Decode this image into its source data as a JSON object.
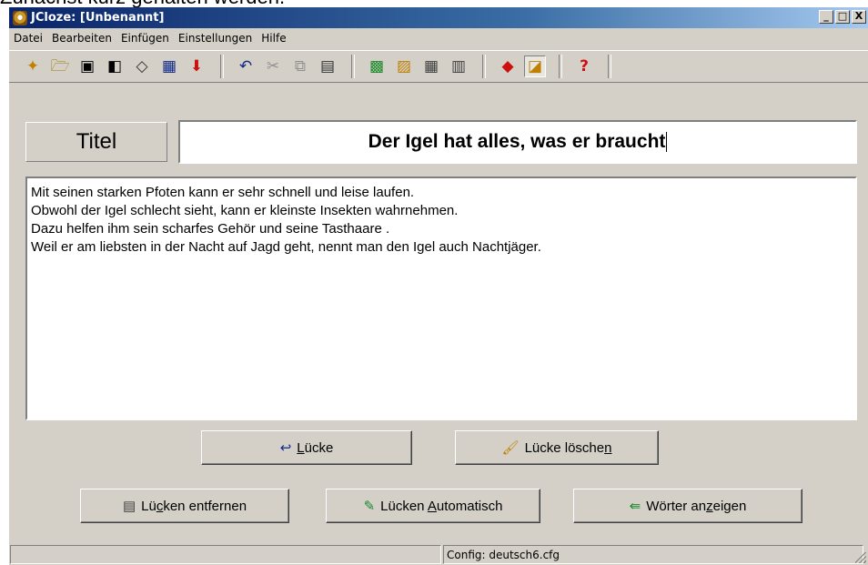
{
  "caption_text": "Zunächst kurz gehalten werden.",
  "window": {
    "title": "JCloze: [Unbenannt]",
    "controls": {
      "minimize": "_",
      "maximize": "□",
      "close": "X"
    }
  },
  "menu": [
    "Datei",
    "Bearbeiten",
    "Einfügen",
    "Einstellungen",
    "Hilfe"
  ],
  "toolbar": {
    "icons": {
      "new": "✦",
      "open": "🗁",
      "save": "▣",
      "save_as": "◧",
      "web": "◇",
      "export": "▦",
      "down": "⬇",
      "undo": "↶",
      "cut": "✂",
      "copy": "⧉",
      "paste": "▤",
      "t1": "▩",
      "t2": "▨",
      "t3": "▦",
      "t4": "▥",
      "t5": "◆",
      "t6": "◪",
      "help": "?"
    },
    "colors": {
      "red": "#cc1010",
      "blue": "#102a88",
      "yellow": "#e8c000",
      "green": "#1a8a2a"
    }
  },
  "title_section": {
    "label": "Titel",
    "value": "Der Igel hat alles, was er braucht"
  },
  "text_lines": [
    "Mit seinen starken Pfoten kann er sehr schnell und leise laufen.",
    "Obwohl der Igel schlecht sieht, kann er kleinste Insekten wahrnehmen.",
    "Dazu helfen ihm sein scharfes Gehör und seine Tasthaare .",
    "Weil er am liebsten in der Nacht auf Jagd geht, nennt man den Igel auch Nachtjäger."
  ],
  "buttons": {
    "gap": {
      "pre": "",
      "ul": "L",
      "post": "ücke",
      "icon": "↩"
    },
    "delete_gap": {
      "pre": "Lücke lösche",
      "ul": "n",
      "post": "",
      "icon": "🖌"
    },
    "remove_gaps": {
      "pre": "Lü",
      "ul": "c",
      "post": "ken entfernen",
      "icon": "▤"
    },
    "auto_gaps": {
      "pre": "Lücken ",
      "ul": "A",
      "post": "utomatisch",
      "icon": "✎"
    },
    "show_words": {
      "pre": "Wörter an",
      "ul": "z",
      "post": "eigen",
      "icon": "⇚"
    }
  },
  "status": {
    "left": "",
    "config": "Config: deutsch6.cfg"
  }
}
